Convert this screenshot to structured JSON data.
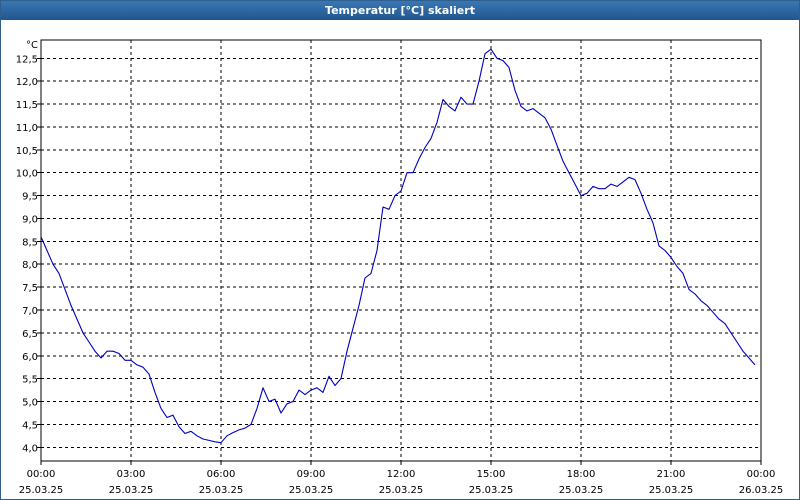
{
  "window": {
    "title": "Temperatur [°C] skaliert"
  },
  "chart_data": {
    "type": "line",
    "title": "Temperatur [°C] skaliert",
    "ylabel": "°C",
    "xlabel": "",
    "ylim": [
      3.7,
      12.9
    ],
    "xlim": [
      0,
      24
    ],
    "y_ticks": [
      "4,0",
      "4,5",
      "5,0",
      "5,5",
      "6,0",
      "6,5",
      "7,0",
      "7,5",
      "8,0",
      "8,5",
      "9,0",
      "9,5",
      "10,0",
      "10,5",
      "11,0",
      "11,5",
      "12,0",
      "12,5"
    ],
    "y_tick_values": [
      4.0,
      4.5,
      5.0,
      5.5,
      6.0,
      6.5,
      7.0,
      7.5,
      8.0,
      8.5,
      9.0,
      9.5,
      10.0,
      10.5,
      11.0,
      11.5,
      12.0,
      12.5
    ],
    "x_ticks": [
      {
        "h": 0,
        "time": "00:00",
        "date": "25.03.25"
      },
      {
        "h": 3,
        "time": "03:00",
        "date": "25.03.25"
      },
      {
        "h": 6,
        "time": "06:00",
        "date": "25.03.25"
      },
      {
        "h": 9,
        "time": "09:00",
        "date": "25.03.25"
      },
      {
        "h": 12,
        "time": "12:00",
        "date": "25.03.25"
      },
      {
        "h": 15,
        "time": "15:00",
        "date": "25.03.25"
      },
      {
        "h": 18,
        "time": "18:00",
        "date": "25.03.25"
      },
      {
        "h": 21,
        "time": "21:00",
        "date": "25.03.25"
      },
      {
        "h": 24,
        "time": "00:00",
        "date": "26.03.25"
      }
    ],
    "grid": true,
    "line_color": "#0000c0",
    "series": [
      {
        "x": [
          0.0,
          0.2,
          0.4,
          0.6,
          0.8,
          1.0,
          1.2,
          1.4,
          1.6,
          1.8,
          2.0,
          2.2,
          2.4,
          2.6,
          2.8,
          3.0,
          3.2,
          3.4,
          3.6,
          3.8,
          4.0,
          4.2,
          4.4,
          4.6,
          4.8,
          5.0,
          5.2,
          5.4,
          5.6,
          5.8,
          6.0,
          6.2,
          6.4,
          6.6,
          6.8,
          7.0,
          7.2,
          7.4,
          7.6,
          7.8,
          8.0,
          8.2,
          8.4,
          8.6,
          8.8,
          9.0,
          9.2,
          9.4,
          9.6,
          9.8,
          10.0,
          10.2,
          10.4,
          10.6,
          10.8,
          11.0,
          11.2,
          11.4,
          11.6,
          11.8,
          12.0,
          12.2,
          12.4,
          12.6,
          12.8,
          13.0,
          13.2,
          13.4,
          13.6,
          13.8,
          14.0,
          14.2,
          14.4,
          14.6,
          14.8,
          15.0,
          15.2,
          15.4,
          15.6,
          15.8,
          16.0,
          16.2,
          16.4,
          16.6,
          16.8,
          17.0,
          17.2,
          17.4,
          17.6,
          17.8,
          18.0,
          18.2,
          18.4,
          18.6,
          18.8,
          19.0,
          19.2,
          19.4,
          19.6,
          19.8,
          20.0,
          20.2,
          20.4,
          20.6,
          20.8,
          21.0,
          21.2,
          21.4,
          21.6,
          21.8,
          22.0,
          22.2,
          22.4,
          22.6,
          22.8,
          23.0,
          23.2,
          23.4,
          23.6,
          23.8
        ],
        "y": [
          8.6,
          8.3,
          8.0,
          7.8,
          7.45,
          7.1,
          6.8,
          6.5,
          6.3,
          6.1,
          5.95,
          6.1,
          6.1,
          6.05,
          5.9,
          5.9,
          5.8,
          5.75,
          5.6,
          5.2,
          4.85,
          4.65,
          4.7,
          4.45,
          4.3,
          4.35,
          4.25,
          4.18,
          4.15,
          4.12,
          4.1,
          4.25,
          4.32,
          4.38,
          4.42,
          4.5,
          4.85,
          5.3,
          5.0,
          5.05,
          4.75,
          4.95,
          5.0,
          5.25,
          5.15,
          5.25,
          5.3,
          5.2,
          5.55,
          5.35,
          5.5,
          6.1,
          6.6,
          7.1,
          7.7,
          7.8,
          8.3,
          9.25,
          9.2,
          9.5,
          9.6,
          10.0,
          10.0,
          10.3,
          10.55,
          10.75,
          11.1,
          11.6,
          11.45,
          11.35,
          11.65,
          11.5,
          11.5,
          12.0,
          12.6,
          12.7,
          12.5,
          12.45,
          12.3,
          11.8,
          11.45,
          11.35,
          11.4,
          11.3,
          11.2,
          10.95,
          10.6,
          10.25,
          10.0,
          9.75,
          9.5,
          9.55,
          9.7,
          9.65,
          9.65,
          9.75,
          9.7,
          9.8,
          9.9,
          9.85,
          9.55,
          9.2,
          8.9,
          8.4,
          8.3,
          8.15,
          7.95,
          7.8,
          7.45,
          7.35,
          7.2,
          7.1,
          6.95,
          6.8,
          6.7,
          6.5,
          6.3,
          6.1,
          5.95,
          5.8
        ]
      }
    ]
  }
}
